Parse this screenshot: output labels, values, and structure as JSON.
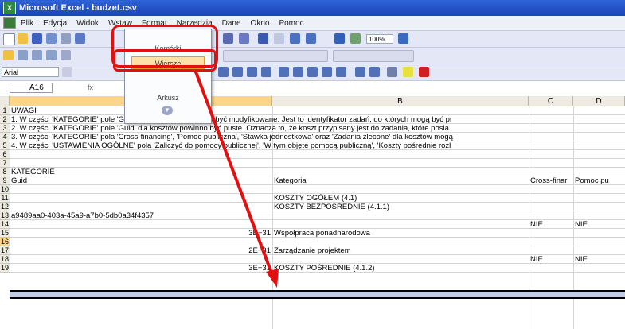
{
  "window": {
    "title": "Microsoft Excel - budzet.csv"
  },
  "menubar": {
    "items": [
      "Plik",
      "Edycja",
      "Widok",
      "Wstaw",
      "Format",
      "Narzędzia",
      "Dane",
      "Okno",
      "Pomoc"
    ]
  },
  "toolbar": {
    "font_name": "Arial",
    "zoom": "100%"
  },
  "formula_bar": {
    "name_box": "A16",
    "fx": "fx"
  },
  "insert_menu": {
    "items": [
      "Komórki",
      "Wiersze",
      "Arkusz"
    ],
    "highlighted": "Wiersze"
  },
  "columns": [
    "A",
    "B",
    "C",
    "D"
  ],
  "selected_column": "A",
  "rows": [
    {
      "n": "1",
      "a": "UWAGI",
      "b": "",
      "c": "",
      "d": ""
    },
    {
      "n": "2",
      "a": "1. W części 'KATEGORIE' pole 'Guid' dla zadań nie powinno być modyfikowane. Jest to identyfikator zadań, do których mogą być pr",
      "b": "",
      "c": "",
      "d": ""
    },
    {
      "n": "3",
      "a": "2. W części 'KATEGORIE' pole 'Guid' dla kosztów powinno być puste. Oznacza to, że koszt przypisany jest do zadania, które posia",
      "b": "",
      "c": "",
      "d": ""
    },
    {
      "n": "4",
      "a": "3. W części 'KATEGORIE' pola 'Cross-financing', 'Pomoc publiczna', 'Stawka jednostkowa' oraz 'Zadania zlecone' dla kosztów mogą",
      "b": "",
      "c": "",
      "d": ""
    },
    {
      "n": "5",
      "a": "4. W części 'USTAWIENIA OGÓLNE' pola 'Zaliczyć do pomocy publicznej', 'W tym objęte pomocą publiczną', 'Koszty pośrednie rozl",
      "b": "",
      "c": "",
      "d": ""
    },
    {
      "n": "6",
      "a": "",
      "b": "",
      "c": "",
      "d": ""
    },
    {
      "n": "7",
      "a": "",
      "b": "",
      "c": "",
      "d": ""
    },
    {
      "n": "8",
      "a": "KATEGORIE",
      "b": "",
      "c": "",
      "d": ""
    },
    {
      "n": "9",
      "a": "Guid",
      "b": "Kategoria",
      "c": "Cross-finar",
      "d": "Pomoc pu"
    },
    {
      "n": "10",
      "a": "",
      "b": "",
      "c": "",
      "d": ""
    },
    {
      "n": "11",
      "a": "",
      "b": "KOSZTY OGÓŁEM (4.1)",
      "c": "",
      "d": ""
    },
    {
      "n": "12",
      "a": "",
      "b": "KOSZTY BEZPOŚREDNIE (4.1.1)",
      "c": "",
      "d": ""
    },
    {
      "n": "13",
      "a": "a9489aa0-403a-45a9-a7b0-5db0a34f4357",
      "b": "",
      "c": "",
      "d": ""
    },
    {
      "n": "14",
      "a": "",
      "b": "",
      "c": "NIE",
      "d": "NIE"
    },
    {
      "n": "15",
      "a": "3E+31",
      "b": "Współpraca ponadnarodowa",
      "c": "",
      "d": ""
    },
    {
      "n": "16",
      "a": "",
      "b": "",
      "c": "",
      "d": ""
    },
    {
      "n": "17",
      "a": "2E+31",
      "b": "Zarządzanie projektem",
      "c": "",
      "d": ""
    },
    {
      "n": "18",
      "a": "",
      "b": "",
      "c": "NIE",
      "d": "NIE"
    },
    {
      "n": "19",
      "a": "3E+31",
      "b": "KOSZTY POŚREDNIE (4.1.2)",
      "c": "",
      "d": ""
    }
  ],
  "selected_row": "16",
  "colors": {
    "annotation": "#e21111",
    "selection": "#fbd68a",
    "title_bar": "#1f4fc8"
  }
}
